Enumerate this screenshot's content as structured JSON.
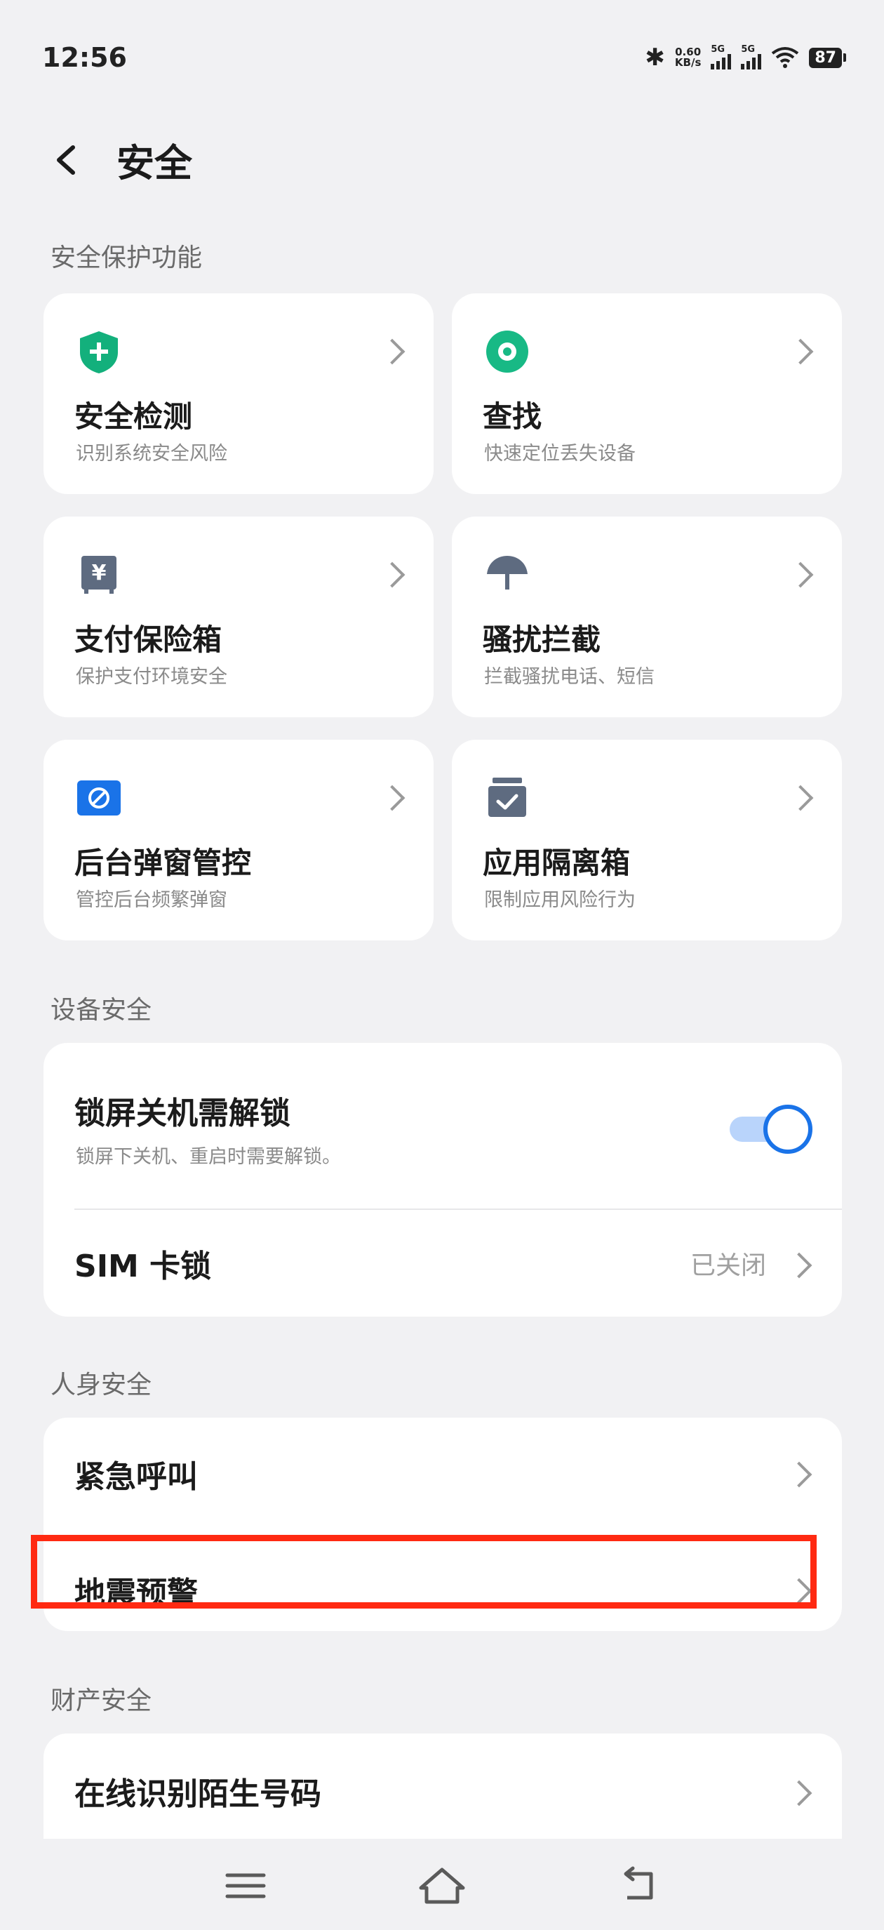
{
  "status_bar": {
    "time": "12:56",
    "net_speed_top": "0.60",
    "net_speed_bottom": "KB/s",
    "sim1": "5G",
    "sim2": "5G",
    "battery": "87"
  },
  "header": {
    "title": "安全"
  },
  "sections": {
    "protection": {
      "label": "安全保护功能"
    },
    "device": {
      "label": "设备安全"
    },
    "personal": {
      "label": "人身安全"
    },
    "property": {
      "label": "财产安全"
    }
  },
  "tiles": [
    {
      "title": "安全检测",
      "subtitle": "识别系统安全风险",
      "icon": "shield-plus-icon",
      "color": "#13b07c"
    },
    {
      "title": "查找",
      "subtitle": "快速定位丢失设备",
      "icon": "locate-disc-icon",
      "color": "#18b985"
    },
    {
      "title": "支付保险箱",
      "subtitle": "保护支付环境安全",
      "icon": "payment-safe-icon",
      "color": "#5e6b80"
    },
    {
      "title": "骚扰拦截",
      "subtitle": "拦截骚扰电话、短信",
      "icon": "umbrella-icon",
      "color": "#5e6b80"
    },
    {
      "title": "后台弹窗管控",
      "subtitle": "管控后台频繁弹窗",
      "icon": "popup-block-icon",
      "color": "#1a73e8"
    },
    {
      "title": "应用隔离箱",
      "subtitle": "限制应用风险行为",
      "icon": "isolation-box-icon",
      "color": "#5e6b80"
    }
  ],
  "device_security": {
    "lock_power": {
      "title": "锁屏关机需解锁",
      "subtitle": "锁屏下关机、重启时需要解锁。",
      "enabled": true
    },
    "sim_lock": {
      "title": "SIM 卡锁",
      "value": "已关闭"
    }
  },
  "personal_safety": {
    "emergency": {
      "title": "紧急呼叫"
    },
    "earthquake": {
      "title": "地震预警"
    }
  },
  "property_safety": {
    "stranger_number": {
      "title": "在线识别陌生号码"
    }
  },
  "colors": {
    "accent": "#1a73e8",
    "highlight": "#ff2a12",
    "background": "#f1f1f3"
  }
}
